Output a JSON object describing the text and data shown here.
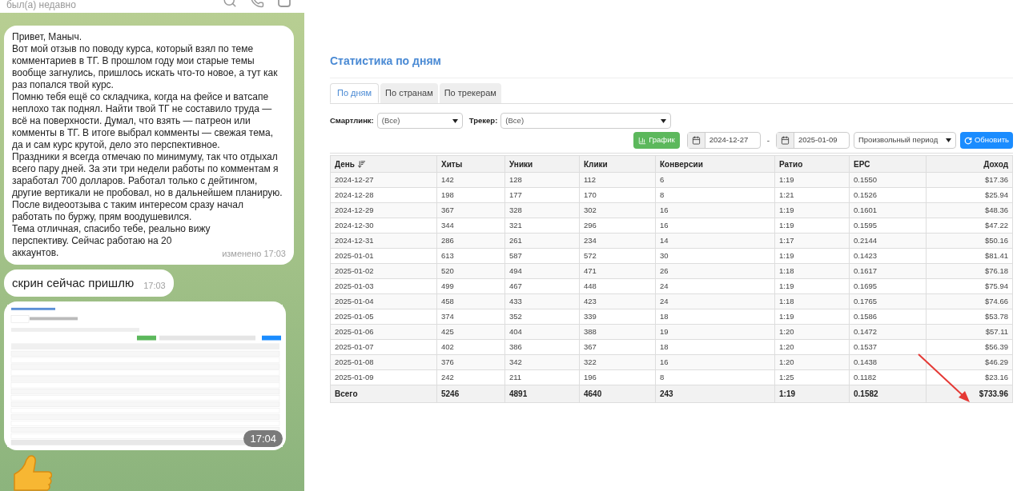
{
  "chat": {
    "status": "был(а) недавно",
    "messages": [
      {
        "kind": "text",
        "paragraphs": [
          "Привет, Маныч.",
          "Вот мой отзыв по поводу курса, который взял по теме комментариев в ТГ. В прошлом году мои старые темы вообще загнулись, пришлось искать что-то новое, а тут как раз попался твой курс.",
          "Помню тебя ещё со складчика, когда на фейсе и ватсапе неплохо так поднял. Найти твой ТГ не составило труда — всё на поверхности. Думал, что взять — патреон или комменты в ТГ. В итоге выбрал комменты — свежая тема, да и сам курс крутой, дело это перспективное.",
          "Праздники я всегда отмечаю по минимуму, так что отдыхал всего пару дней. За эти три недели работы по комментам я заработал 700 долларов. Работал только с дейтингом, другие вертикали не пробовал, но в дальнейшем планирую. После видеоотзыва с таким интересом сразу начал работать по буржу, прям воодушевился.",
          "Тема отличная, спасибо тебе, реально вижу перспективу. Сейчас работаю на 20 аккаунтов."
        ],
        "meta": "изменено 17:03"
      },
      {
        "kind": "text",
        "paragraphs": [
          "скрин сейчас пришлю"
        ],
        "meta": "17:03"
      },
      {
        "kind": "image",
        "meta": "17:04"
      },
      {
        "kind": "sticker"
      }
    ]
  },
  "page": {
    "title": "Статистика по дням",
    "tabs": [
      {
        "label": "По дням",
        "selected": true
      },
      {
        "label": "По странам",
        "selected": false
      },
      {
        "label": "По трекерам",
        "selected": false
      }
    ],
    "filters": [
      {
        "label": "Смартлинк:",
        "value": "(Все)"
      },
      {
        "label": "Трекер:",
        "value": "(Все)"
      }
    ],
    "chart_button": "График",
    "date_from": "2024-12-27",
    "separator": "-",
    "date_to": "2025-01-09",
    "period": "Произвольный период",
    "refresh_button": "Обновить"
  },
  "table": {
    "columns": [
      "День",
      "Хиты",
      "Уники",
      "Клики",
      "Конверсии",
      "Ратио",
      "EPC",
      "Доход"
    ],
    "rows": [
      [
        "2024-12-27",
        "142",
        "128",
        "112",
        "6",
        "1:19",
        "0.1550",
        "$17.36"
      ],
      [
        "2024-12-28",
        "198",
        "177",
        "170",
        "8",
        "1:21",
        "0.1526",
        "$25.94"
      ],
      [
        "2024-12-29",
        "367",
        "328",
        "302",
        "16",
        "1:19",
        "0.1601",
        "$48.36"
      ],
      [
        "2024-12-30",
        "344",
        "321",
        "296",
        "16",
        "1:19",
        "0.1595",
        "$47.22"
      ],
      [
        "2024-12-31",
        "286",
        "261",
        "234",
        "14",
        "1:17",
        "0.2144",
        "$50.16"
      ],
      [
        "2025-01-01",
        "613",
        "587",
        "572",
        "30",
        "1:19",
        "0.1423",
        "$81.41"
      ],
      [
        "2025-01-02",
        "520",
        "494",
        "471",
        "26",
        "1:18",
        "0.1617",
        "$76.18"
      ],
      [
        "2025-01-03",
        "499",
        "467",
        "448",
        "24",
        "1:19",
        "0.1695",
        "$75.94"
      ],
      [
        "2025-01-04",
        "458",
        "433",
        "423",
        "24",
        "1:18",
        "0.1765",
        "$74.66"
      ],
      [
        "2025-01-05",
        "374",
        "352",
        "339",
        "18",
        "1:19",
        "0.1586",
        "$53.78"
      ],
      [
        "2025-01-06",
        "425",
        "404",
        "388",
        "19",
        "1:20",
        "0.1472",
        "$57.11"
      ],
      [
        "2025-01-07",
        "402",
        "386",
        "367",
        "18",
        "1:20",
        "0.1537",
        "$56.39"
      ],
      [
        "2025-01-08",
        "376",
        "342",
        "322",
        "16",
        "1:20",
        "0.1438",
        "$46.29"
      ],
      [
        "2025-01-09",
        "242",
        "211",
        "196",
        "8",
        "1:25",
        "0.1182",
        "$23.16"
      ]
    ],
    "total": [
      "Всего",
      "5246",
      "4891",
      "4640",
      "243",
      "1:19",
      "0.1582",
      "$733.96"
    ]
  }
}
